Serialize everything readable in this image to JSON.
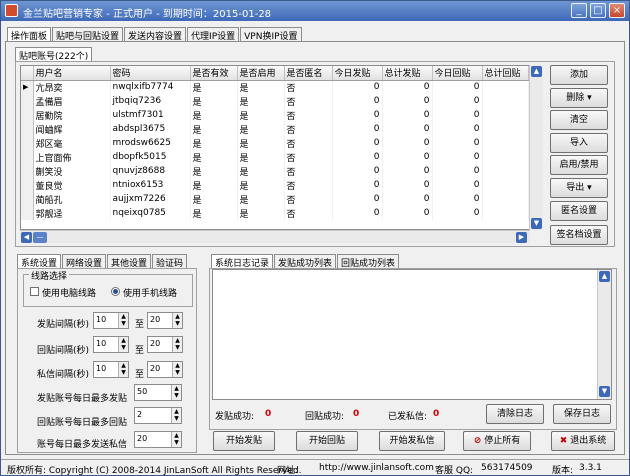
{
  "window": {
    "title": "金兰贴吧营销专家 - 正式用户 - 到期时间：2015-01-28",
    "min": "_",
    "max": "□",
    "close": "×"
  },
  "main_tabs": [
    "操作面板",
    "贴吧与回贴设置",
    "发送内容设置",
    "代理IP设置",
    "VPN换IP设置"
  ],
  "accounts": {
    "tab": "贴吧账号(222个)",
    "columns": [
      "用户名",
      "密码",
      "是否有效",
      "是否启用",
      "是否匿名",
      "今日发贴",
      "总计发贴",
      "今日回贴",
      "总计回贴"
    ],
    "rows": [
      [
        "亢昂奕",
        "nwqlxifb7774",
        "是",
        "是",
        "否",
        "0",
        "0",
        "0"
      ],
      [
        "孟備眉",
        "jtbqiq7236",
        "是",
        "是",
        "否",
        "0",
        "0",
        "0"
      ],
      [
        "居勤院",
        "ulstmf7301",
        "是",
        "是",
        "否",
        "0",
        "0",
        "0"
      ],
      [
        "闻蛐辉",
        "abdspl3675",
        "是",
        "是",
        "否",
        "0",
        "0",
        "0"
      ],
      [
        "郑区毫",
        "mrodsw6625",
        "是",
        "是",
        "否",
        "0",
        "0",
        "0"
      ],
      [
        "上官面佈",
        "dbopfk5015",
        "是",
        "是",
        "否",
        "0",
        "0",
        "0"
      ],
      [
        "蒯笑没",
        "qnuvjz8688",
        "是",
        "是",
        "否",
        "0",
        "0",
        "0"
      ],
      [
        "董良觉",
        "ntniox6153",
        "是",
        "是",
        "否",
        "0",
        "0",
        "0"
      ],
      [
        "蔺船孔",
        "aujjxm7226",
        "是",
        "是",
        "否",
        "0",
        "0",
        "0"
      ],
      [
        "郭靓迳",
        "nqeixq0785",
        "是",
        "是",
        "否",
        "0",
        "0",
        "0"
      ]
    ]
  },
  "side_buttons": {
    "add": "添加",
    "delete": "删除",
    "clear": "清空",
    "import": "导入",
    "enable": "启用/禁用",
    "export": "导出",
    "anon": "匿名设置",
    "sign": "签名档设置"
  },
  "settings_tabs": [
    "系统设置",
    "网络设置",
    "其他设置",
    "验证码"
  ],
  "line_group": {
    "title": "线路选择",
    "pc": "使用电脑线路",
    "mobile": "使用手机线路"
  },
  "intervals": {
    "to": "至",
    "post": {
      "label": "发贴间隔(秒)",
      "from": "10",
      "to_val": "20"
    },
    "reply": {
      "label": "回贴间隔(秒)",
      "from": "10",
      "to_val": "20"
    },
    "pm": {
      "label": "私信间隔(秒)",
      "from": "10",
      "to_val": "20"
    }
  },
  "limits": {
    "post": {
      "label": "发贴账号每日最多发贴",
      "value": "50"
    },
    "reply": {
      "label": "回贴账号每日最多回贴",
      "value": "2"
    },
    "pm": {
      "label": "账号每日最多发送私信",
      "value": "20"
    }
  },
  "log_tabs": [
    "系统日志记录",
    "发贴成功列表",
    "回贴成功列表"
  ],
  "stats": {
    "post_label": "发贴成功:",
    "post": "0",
    "reply_label": "回贴成功:",
    "reply": "0",
    "pm_label": "已发私信:",
    "pm": "0"
  },
  "log_buttons": {
    "clear": "清除日志",
    "save": "保存日志"
  },
  "actions": {
    "start_post": "开始发贴",
    "start_reply": "开始回贴",
    "start_pm": "开始发私信",
    "stop": "停止所有",
    "exit": "退出系统"
  },
  "status": {
    "copyright": "版权所有:  Copyright (C) 2008-2014 JinLanSoft All Rights Reserved.",
    "site_label": "网址:",
    "site": "http://www.jinlansoft.com",
    "qq_label": "客服 QQ:",
    "qq": "563174509",
    "ver_label": "版本:",
    "ver": "3.3.1"
  },
  "colors": {
    "title_bar": "#3e69b8",
    "count_red": "#d00000"
  }
}
